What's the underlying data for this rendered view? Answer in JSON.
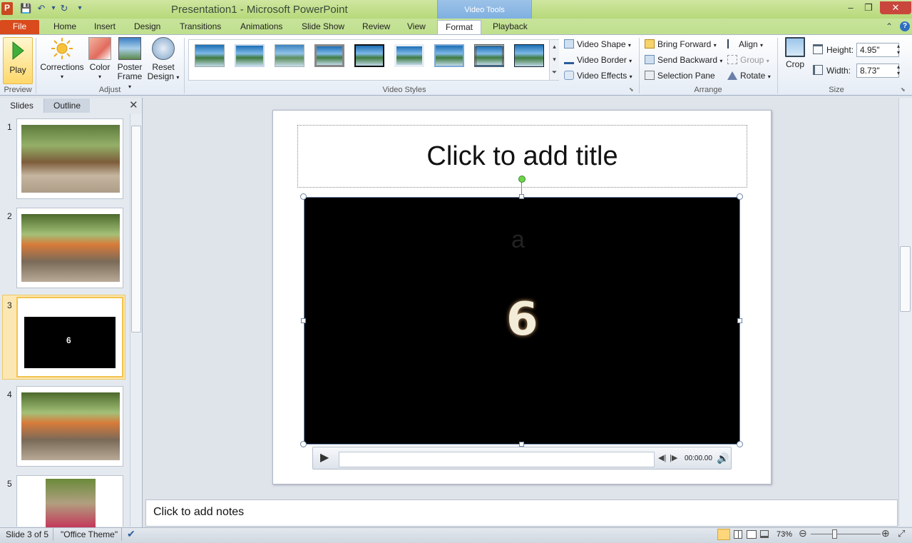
{
  "window": {
    "title": "Presentation1  -  Microsoft PowerPoint",
    "contextual_group": "Video Tools",
    "minimize": "–",
    "restore": "❐",
    "close": "✕"
  },
  "quick_access": {
    "app_icon": "P",
    "save": "💾",
    "undo": "↶",
    "undo_dd": "▾",
    "redo": "↻",
    "customize": "▾"
  },
  "tabs": [
    "File",
    "Home",
    "Insert",
    "Design",
    "Transitions",
    "Animations",
    "Slide Show",
    "Review",
    "View",
    "Format",
    "Playback"
  ],
  "help": {
    "collapse": "⌃",
    "help": "?"
  },
  "ribbon": {
    "preview": {
      "play": "Play",
      "group": "Preview"
    },
    "adjust": {
      "corrections": "Corrections",
      "color": "Color",
      "poster_frame_1": "Poster",
      "poster_frame_2": "Frame",
      "reset_design_1": "Reset",
      "reset_design_2": "Design",
      "group": "Adjust",
      "dd": "▾"
    },
    "video_styles": {
      "group": "Video Styles",
      "shape": "Video Shape",
      "border": "Video Border",
      "effects": "Video Effects",
      "scroll_up": "▴",
      "scroll_down": "▾",
      "more": "⏷",
      "launcher": "⬊"
    },
    "arrange": {
      "bring_forward": "Bring Forward",
      "send_backward": "Send Backward",
      "selection_pane": "Selection Pane",
      "align": "Align",
      "group_btn": "Group",
      "rotate": "Rotate",
      "group": "Arrange"
    },
    "size": {
      "crop": "Crop",
      "height_label": "Height:",
      "height_value": "4.95\"",
      "width_label": "Width:",
      "width_value": "8.73\"",
      "group": "Size",
      "spin_up": "▴",
      "spin_down": "▾",
      "launcher": "⬊"
    }
  },
  "slides_pane": {
    "tab_slides": "Slides",
    "tab_outline": "Outline",
    "close": "✕",
    "numbers": [
      "1",
      "2",
      "3",
      "4",
      "5"
    ],
    "thumb3_glyph": "6"
  },
  "slide": {
    "title_placeholder": "Click to add title",
    "video_glyph": "6",
    "video_ghost": "a",
    "player": {
      "play": "▶",
      "back": "◀|",
      "forward": "|▶",
      "time": "00:00.00",
      "volume": "🔊"
    }
  },
  "notes": {
    "placeholder": "Click to add notes"
  },
  "status": {
    "slide_info": "Slide 3 of 5",
    "theme": "\"Office Theme\"",
    "spell": "✔",
    "zoom": "73%",
    "zoom_out": "⊖",
    "zoom_in": "⊕",
    "fit": "⤢"
  }
}
